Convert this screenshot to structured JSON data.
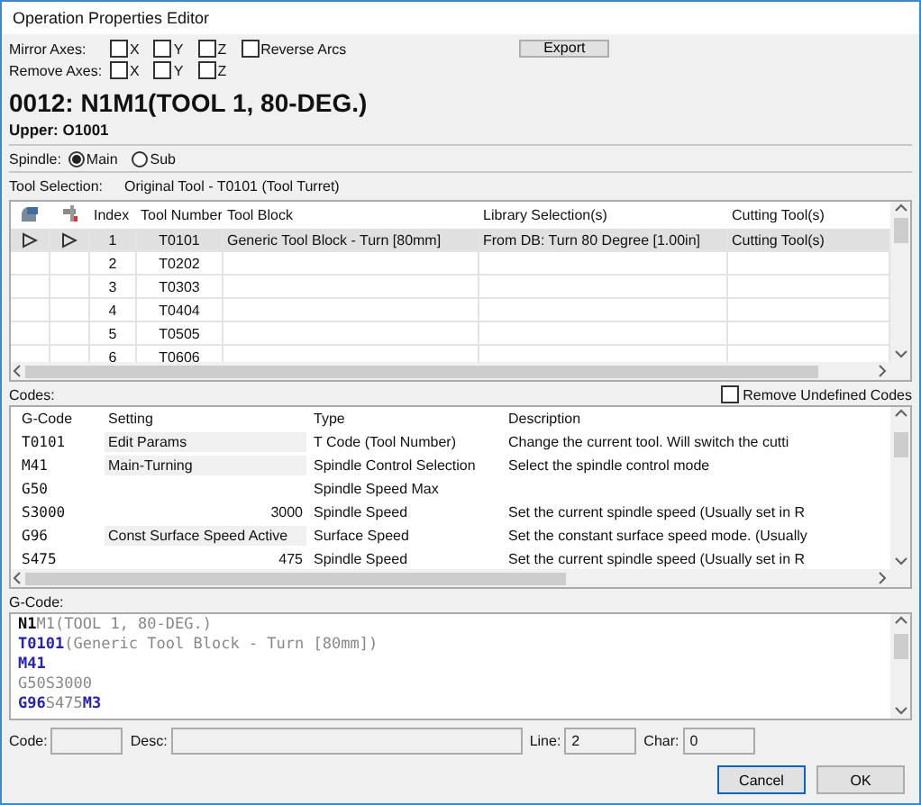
{
  "window": {
    "title": "Operation Properties Editor"
  },
  "mirror_axes": {
    "label": "Mirror Axes:",
    "options": [
      {
        "label": "X",
        "checked": false
      },
      {
        "label": "Y",
        "checked": false
      },
      {
        "label": "Z",
        "checked": false
      }
    ],
    "reverse_arcs": {
      "label": "Reverse Arcs",
      "checked": false
    }
  },
  "export_button": "Export",
  "remove_axes": {
    "label": "Remove Axes:",
    "options": [
      {
        "label": "X",
        "checked": false
      },
      {
        "label": "Y",
        "checked": false
      },
      {
        "label": "Z",
        "checked": false
      }
    ]
  },
  "heading": "0012: N1M1(TOOL 1, 80-DEG.)",
  "subheading": "Upper: O1001",
  "spindle": {
    "label": "Spindle:",
    "options": [
      {
        "label": "Main",
        "selected": true
      },
      {
        "label": "Sub",
        "selected": false
      }
    ]
  },
  "tool_selection": {
    "label": "Tool Selection:",
    "value": "Original Tool - T0101 (Tool Turret)"
  },
  "tool_table": {
    "columns": [
      "Index",
      "Tool Number",
      "Tool Block",
      "Library Selection(s)",
      "Cutting Tool(s)"
    ],
    "rows": [
      {
        "index": "1",
        "tool_number": "T0101",
        "tool_block": "Generic Tool Block - Turn [80mm]",
        "library": "From DB: Turn 80 Degree [1.00in]",
        "cutting_tools": "Cutting Tool(s)",
        "selected": true
      },
      {
        "index": "2",
        "tool_number": "T0202",
        "selected": false
      },
      {
        "index": "3",
        "tool_number": "T0303",
        "selected": false
      },
      {
        "index": "4",
        "tool_number": "T0404",
        "selected": false
      },
      {
        "index": "5",
        "tool_number": "T0505",
        "selected": false
      },
      {
        "index": "6",
        "tool_number": "T0606",
        "selected": false
      }
    ]
  },
  "codes": {
    "label": "Codes:",
    "remove_undefined": {
      "label": "Remove Undefined Codes",
      "checked": false
    },
    "columns": [
      "G-Code",
      "Setting",
      "Type",
      "Description"
    ],
    "rows": [
      {
        "gcode": "T0101",
        "setting": "Edit Params",
        "highlighted": true,
        "type": "T Code (Tool Number)",
        "description": "Change the current tool.  Will switch the cutti"
      },
      {
        "gcode": "M41",
        "setting": "Main-Turning",
        "highlighted": true,
        "type": "Spindle Control Selection",
        "description": "Select the spindle control mode"
      },
      {
        "gcode": "G50",
        "type": "Spindle Speed Max"
      },
      {
        "gcode": "S3000",
        "setting": "3000",
        "highlighted": false,
        "type": "Spindle Speed",
        "description": "Set the current spindle speed (Usually set in R"
      },
      {
        "gcode": "G96",
        "setting": "Const Surface Speed Active",
        "highlighted": true,
        "type": "Surface Speed",
        "description": "Set the constant surface speed mode. (Usually"
      },
      {
        "gcode": "S475",
        "setting": "475",
        "highlighted": false,
        "type": "Spindle Speed",
        "description": "Set the current spindle speed (Usually set in R"
      }
    ]
  },
  "gcode": {
    "label": "G-Code:",
    "lines": [
      [
        {
          "text": "N1",
          "kind": "number"
        },
        {
          "text": "M1(TOOL 1, 80-DEG.)",
          "kind": "plain"
        }
      ],
      [
        {
          "text": "T0101",
          "kind": "code"
        },
        {
          "text": "(Generic Tool Block - Turn [80mm])",
          "kind": "plain"
        }
      ],
      [
        {
          "text": "M41",
          "kind": "code"
        }
      ],
      [
        {
          "text": "G50S3000",
          "kind": "plain"
        }
      ],
      [
        {
          "text": "G96",
          "kind": "code"
        },
        {
          "text": "S475",
          "kind": "plain"
        },
        {
          "text": "M3",
          "kind": "code"
        }
      ]
    ]
  },
  "fields": [
    {
      "label": "Code:",
      "kind": "code"
    },
    {
      "label": "Desc:",
      "kind": "desc"
    },
    {
      "label": "Line:",
      "value": "2",
      "kind": "num"
    },
    {
      "label": "Char:",
      "value": "0",
      "kind": "num"
    }
  ],
  "buttons": [
    {
      "label": "Cancel",
      "default": true
    },
    {
      "label": "OK",
      "default": false
    }
  ]
}
